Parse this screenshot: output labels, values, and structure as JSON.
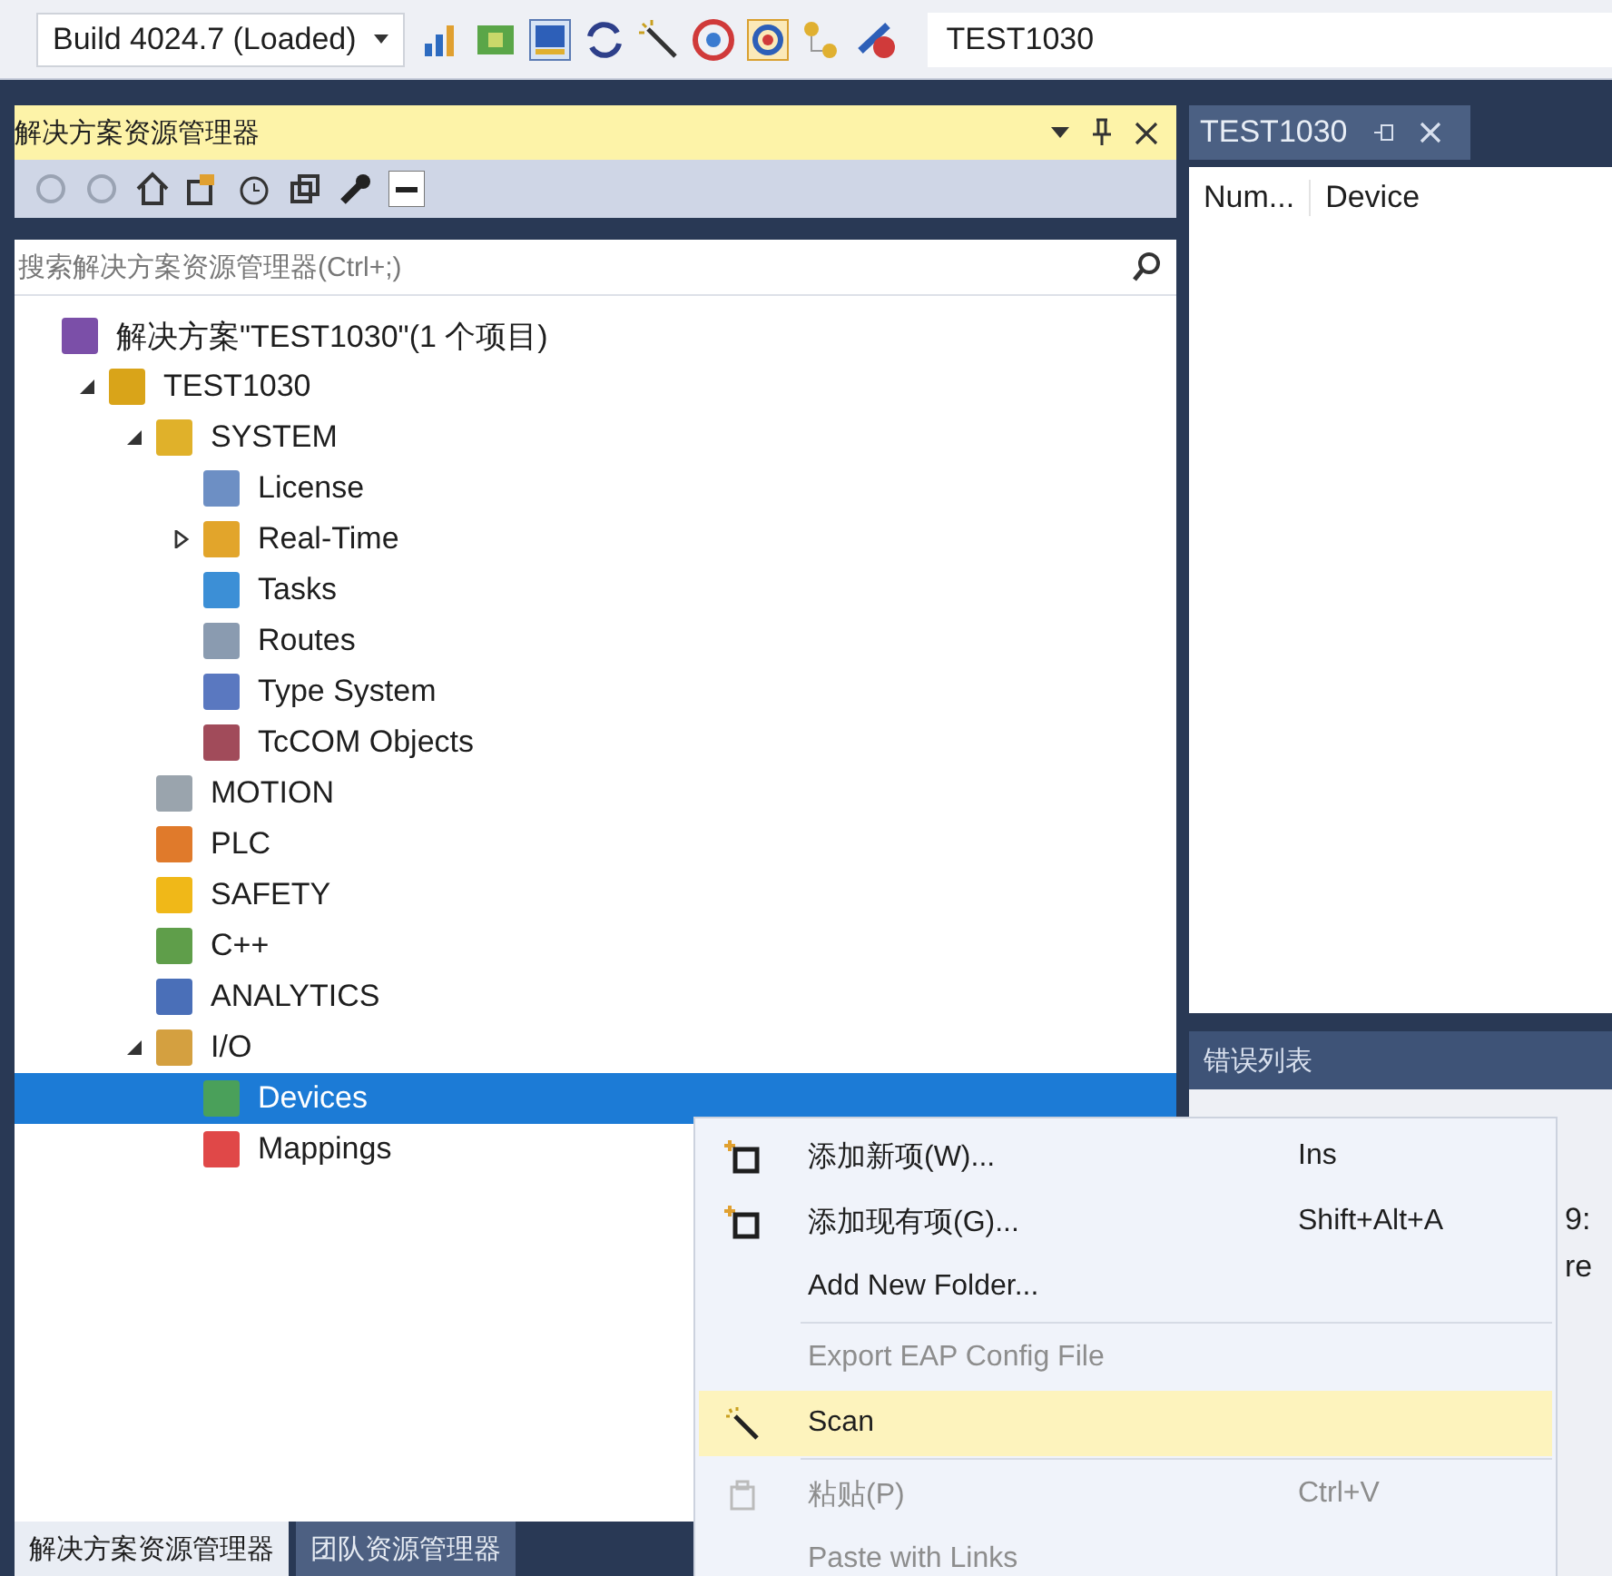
{
  "toolbar": {
    "config": "Build 4024.7 (Loaded)",
    "target": "TEST1030"
  },
  "explorer": {
    "title": "解决方案资源管理器",
    "search": {
      "placeholder": "搜索解决方案资源管理器(Ctrl+;)"
    },
    "tree": [
      {
        "label": "解决方案\"TEST1030\"(1 个项目)",
        "selected": false,
        "children": [
          {
            "label": "TEST1030",
            "expanded": true,
            "selected": false,
            "children": [
              {
                "label": "SYSTEM",
                "expanded": true,
                "selected": false,
                "children": [
                  {
                    "label": "License",
                    "selected": false
                  },
                  {
                    "label": "Real-Time",
                    "expanded": false,
                    "selected": false
                  },
                  {
                    "label": "Tasks",
                    "selected": false
                  },
                  {
                    "label": "Routes",
                    "selected": false
                  },
                  {
                    "label": "Type System",
                    "selected": false
                  },
                  {
                    "label": "TcCOM Objects",
                    "selected": false
                  }
                ]
              },
              {
                "label": "MOTION",
                "selected": false
              },
              {
                "label": "PLC",
                "selected": false
              },
              {
                "label": "SAFETY",
                "selected": false
              },
              {
                "label": "C++",
                "selected": false
              },
              {
                "label": "ANALYTICS",
                "selected": false
              },
              {
                "label": "I/O",
                "expanded": true,
                "selected": false,
                "children": [
                  {
                    "label": "Devices",
                    "selected": true
                  },
                  {
                    "label": "Mappings",
                    "selected": false
                  }
                ]
              }
            ]
          }
        ]
      }
    ]
  },
  "device_panel": {
    "tab": "TEST1030",
    "columns": [
      "Num...",
      "Device"
    ]
  },
  "error_list": {
    "title": "错误列表",
    "fragments": [
      "9:",
      "re"
    ]
  },
  "bottom_tabs": [
    {
      "label": "解决方案资源管理器",
      "selected": true
    },
    {
      "label": "团队资源管理器",
      "selected": false
    }
  ],
  "context_menu": [
    {
      "kind": "add",
      "label": "添加新项(W)...",
      "shortcut": "Ins",
      "disabled": false,
      "selected": false
    },
    {
      "kind": "add",
      "label": "添加现有项(G)...",
      "shortcut": "Shift+Alt+A",
      "disabled": false,
      "selected": false
    },
    {
      "kind": "plain",
      "label": "Add New Folder...",
      "disabled": false,
      "selected": false
    },
    {
      "kind": "separator"
    },
    {
      "kind": "plain",
      "label": "Export EAP Config File",
      "disabled": true,
      "selected": false
    },
    {
      "kind": "scan",
      "label": "Scan",
      "disabled": false,
      "selected": true
    },
    {
      "kind": "separator"
    },
    {
      "kind": "paste",
      "label": "粘贴(P)",
      "shortcut": "Ctrl+V",
      "disabled": true,
      "selected": false
    },
    {
      "kind": "plain",
      "label": "Paste with Links",
      "disabled": true,
      "selected": false
    }
  ]
}
